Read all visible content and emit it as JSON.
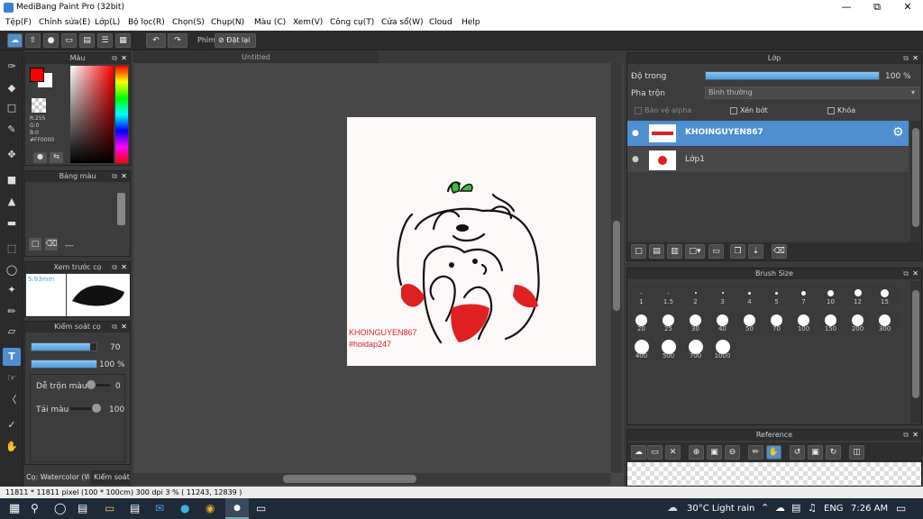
{
  "app": {
    "title": "MediBang Paint Pro (32bit)"
  },
  "menu": [
    "Tệp(F)",
    "Chỉnh sửa(E)",
    "Lớp(L)",
    "Bộ lọc(R)",
    "Chọn(S)",
    "Chụp(N)",
    "Màu (C)",
    "Xem(V)",
    "Công cụ(T)",
    "Cửa sổ(W)",
    "Cloud",
    "Help"
  ],
  "toolbar": {
    "brush_label": "Phím",
    "reset_label": "Đặt lại"
  },
  "color_panel": {
    "title": "Màu",
    "r": "R:255",
    "g": "G:0",
    "b": "B:0",
    "hex": "#FF0000",
    "fg": "#ff0000",
    "bg": "#ffffff"
  },
  "palette_panel": {
    "title": "Bảng màu",
    "dash": "---"
  },
  "preview_panel": {
    "title": "Xem trước cọ",
    "size": "5.93mm"
  },
  "brush_control": {
    "title": "Kiểm soát cọ",
    "size_value": "70",
    "opacity_value": "100 %",
    "blend_label": "Dễ trộn màu",
    "blend_value": "0",
    "amount_label": "Tải màu",
    "amount_value": "100",
    "size_fraction": 0.9,
    "opacity_fraction": 1.0
  },
  "bottom_tabs": [
    "Cọ: Watercolor (W...",
    "Kiểm soát..."
  ],
  "doc_tab": "Untitled",
  "canvas_text": {
    "line1": "KHOINGUYEN867",
    "line2": "#hoidap247"
  },
  "layer_panel": {
    "title": "Lớp",
    "opacity_label": "Độ trong",
    "opacity_value": "100 %",
    "opacity_fraction": 1.0,
    "blend_label": "Pha trộn",
    "blend_value": "Bình thường",
    "protect_alpha": "Bảo vệ alpha",
    "clipping": "Xén bớt",
    "lock": "Khóa",
    "layers": [
      {
        "name": "KHOINGUYEN867",
        "selected": true
      },
      {
        "name": "Lớp1",
        "selected": false
      }
    ]
  },
  "brush_size_panel": {
    "title": "Brush Size",
    "sizes": [
      "1",
      "1.5",
      "2",
      "3",
      "4",
      "5",
      "7",
      "10",
      "12",
      "15",
      "20",
      "25",
      "30",
      "40",
      "50",
      "70",
      "100",
      "150",
      "200",
      "300",
      "400",
      "500",
      "700",
      "1000"
    ]
  },
  "reference_panel": {
    "title": "Reference"
  },
  "status": {
    "text": "11811 * 11811 pixel  (100 * 100cm)  300 dpi  3 %  ( 11243, 12839 )"
  },
  "taskbar": {
    "weather": "30°C  Light rain",
    "lang": "ENG",
    "time": "7:26 AM"
  },
  "colors": {
    "accent": "#4a9be0",
    "selected_layer": "#4d8fd0"
  }
}
